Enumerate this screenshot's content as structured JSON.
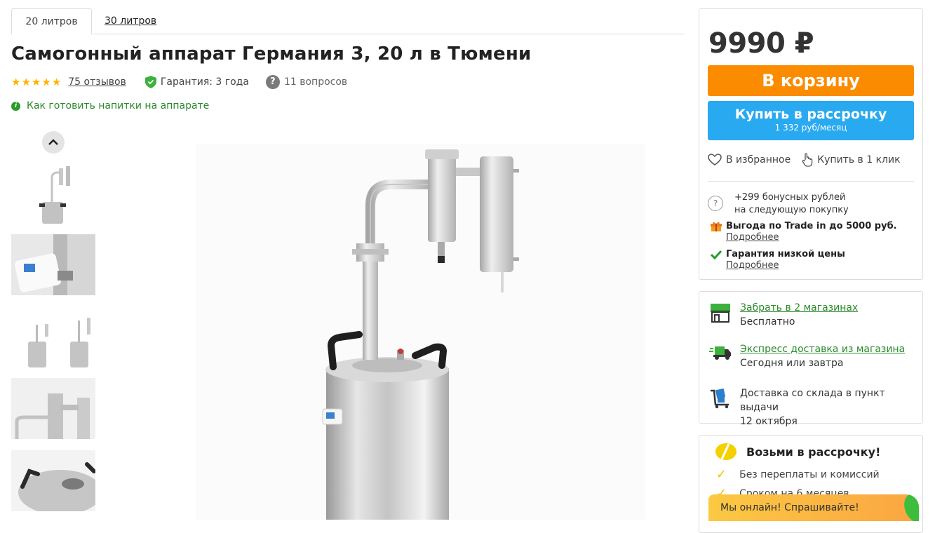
{
  "tabs": [
    {
      "label": "20 литров",
      "active": true
    },
    {
      "label": "30 литров",
      "active": false
    }
  ],
  "product": {
    "title": "Самогонный аппарат Германия 3, 20 л в Тюмени",
    "rating_stars": 5,
    "reviews_label": "75 отзывов",
    "guarantee_label": "Гарантия: 3 года",
    "questions_label": "11 вопросов",
    "howto_label": "Как готовить напитки на аппарате"
  },
  "thumbnails": [
    "thumb-1",
    "thumb-2",
    "thumb-3",
    "thumb-4",
    "thumb-5"
  ],
  "buybox": {
    "price": "9990 ₽",
    "cart_label": "В корзину",
    "credit_label": "Купить в рассрочку",
    "credit_sub": "1 332 руб/месяц",
    "favorite_label": "В избранное",
    "oneclick_label": "Купить в 1 клик",
    "bonus_line1": "+299 бонусных рублей",
    "bonus_line2": "на следующую покупку",
    "tradein_label": "Выгода по Trade in до 5000 руб.",
    "tradein_more": "Подробнее",
    "lowprice_label": "Гарантия низкой цены",
    "lowprice_more": "Подробнее"
  },
  "delivery": {
    "pickup_title": "Забрать в 2 магазинах",
    "pickup_sub": "Бесплатно",
    "express_title": "Экспресс доставка из магазина",
    "express_sub": "Сегодня или завтра",
    "warehouse_title": "Доставка со склада в пункт выдачи",
    "warehouse_sub": "12 октября"
  },
  "installment": {
    "title": "Возьми в рассрочку!",
    "items": [
      "Без переплаты и комиссий",
      "Сроком на 6 месяцев"
    ]
  },
  "chat": {
    "label": "Мы онлайн! Спрашивайте!"
  },
  "colors": {
    "accent_orange": "#fb8c00",
    "accent_blue": "#29a9f0",
    "green_link": "#2b8a2b",
    "star": "#ffb400"
  }
}
